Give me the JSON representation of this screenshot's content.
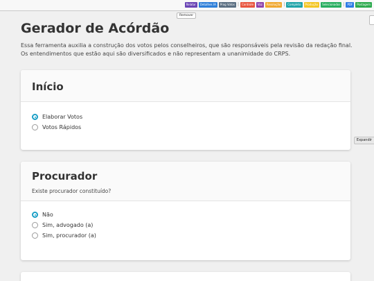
{
  "toolbar": {
    "buttons": [
      {
        "label": "Relatar",
        "color": "#6a45b5"
      },
      {
        "label": "Detalhes IA",
        "color": "#2e7fd9"
      },
      {
        "label": "Prog Votos",
        "color": "#5b6f82"
      },
      {
        "label": "Controle",
        "color": "#e8553e"
      },
      {
        "label": "Voz",
        "color": "#8e44ad"
      },
      {
        "label": "Resolução",
        "color": "#f0a830"
      },
      {
        "label": "Completo",
        "color": "#1fa3a8"
      },
      {
        "label": "Produção",
        "color": "#f3c623"
      },
      {
        "label": "Selecionados",
        "color": "#27ae60"
      },
      {
        "label": "PDF",
        "color": "#2d7be5"
      },
      {
        "label": "Postagem",
        "color": "#2eaa4f"
      }
    ],
    "remover_label": "Remover",
    "expand_label": "Expandir"
  },
  "page": {
    "title": "Gerador de Acórdão",
    "intro": "Essa ferramenta auxilia a construção dos votos pelos conselheiros, que são responsáveis pela revisão da redação final. Os entendimentos que estão aqui são diversificados e não representam a unanimidade do CRPS."
  },
  "inicio": {
    "title": "Início",
    "options": [
      {
        "label": "Elaborar Votos",
        "checked": true
      },
      {
        "label": "Votos Rápidos",
        "checked": false
      }
    ]
  },
  "procurador": {
    "title": "Procurador",
    "question": "Existe procurador constituído?",
    "options": [
      {
        "label": "Não",
        "checked": true
      },
      {
        "label": "Sim, advogado (a)",
        "checked": false
      },
      {
        "label": "Sim, procurador (a)",
        "checked": false
      }
    ]
  },
  "colors": {
    "accent": "#1a9fc6"
  }
}
